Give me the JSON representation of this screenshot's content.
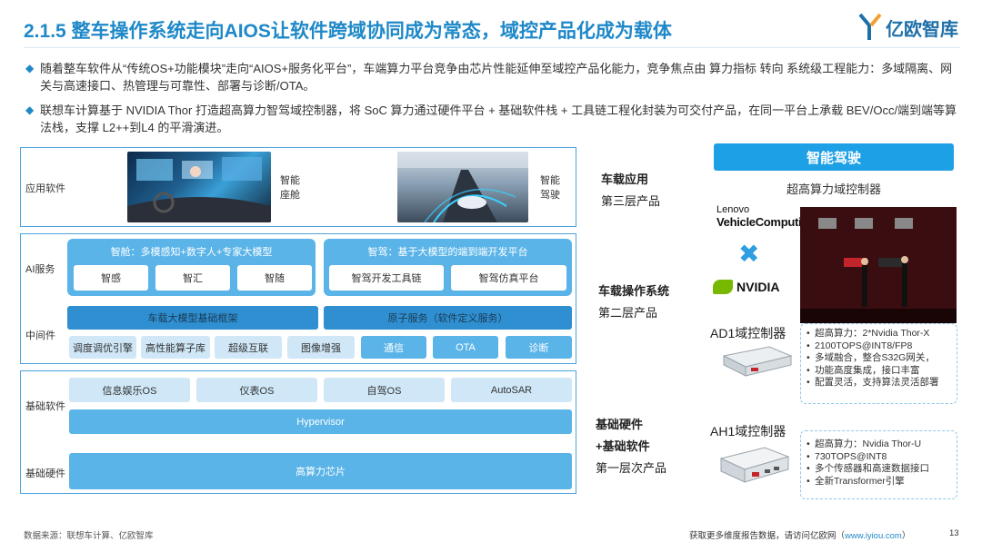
{
  "header": {
    "title": "2.1.5 整车操作系统走向AIOS让软件跨域协同成为常态，域控产品化成为载体",
    "logo_text": "亿欧智库"
  },
  "bullets": [
    "随着整车软件从“传统OS+功能模块”走向“AIOS+服务化平台”，车端算力平台竞争由芯片性能延伸至域控产品化能力，竞争焦点由 算力指标 转向 系统级工程能力：多域隔离、网关与高速接口、热管理与可靠性、部署与诊断/OTA。",
    "联想车计算基于 NVIDIA Thor 打造超高算力智驾域控制器，将 SoC 算力通过硬件平台 + 基础软件栈 + 工具链工程化封装为可交付产品，在同一平台上承载 BEV/Occ/端到端等算法栈，支撑 L2++到L4 的平滑演进。"
  ],
  "stack": {
    "app_row": {
      "label": "应用软件",
      "caption1": "智能\n座舱",
      "caption2": "智能\n驾驶"
    },
    "ai_row": {
      "label": "AI服务",
      "group1_title": "智舱：多模感知+数字人+专家大模型",
      "group1_items": [
        "智感",
        "智汇",
        "智随"
      ],
      "group2_title": "智驾：基于大模型的端到端开发平台",
      "group2_items": [
        "智驾开发工具链",
        "智驾仿真平台"
      ]
    },
    "middleware_row": {
      "label": "中间件",
      "top_left": "车载大模型基础框架",
      "top_right": "原子服务（软件定义服务）",
      "items": [
        "调度调优引擎",
        "高性能算子库",
        "超级互联",
        "图像增强",
        "通信",
        "OTA",
        "诊断"
      ]
    },
    "basesw_row": {
      "label": "基础软件",
      "items": [
        "信息娱乐OS",
        "仪表OS",
        "自驾OS",
        "AutoSAR"
      ],
      "hypervisor": "Hypervisor"
    },
    "hw_row": {
      "label": "基础硬件",
      "chip": "高算力芯片"
    }
  },
  "side_labels": {
    "layer3_title": "车载应用",
    "layer3_sub": "第三层产品",
    "layer2_title": "车载操作系统",
    "layer2_sub": "第二层产品",
    "layer1_title_a": "基础硬件",
    "layer1_title_b": "+基础软件",
    "layer1_sub": "第一层次产品"
  },
  "right_panel": {
    "banner": "智能驾驶",
    "subtitle": "超高算力域控制器",
    "lenovo_small": "Lenovo",
    "lenovo_big": "VehicleComputing",
    "nvidia": "NVIDIA",
    "ad1": {
      "title": "AD1域控制器",
      "specs": [
        "超高算力：2*Nvidia Thor-X",
        "2100TOPS@INT8/FP8",
        "多域融合，整合S32G网关，",
        "功能高度集成，接口丰富",
        "配置灵活，支持算法灵活部署"
      ]
    },
    "ah1": {
      "title": "AH1域控制器",
      "specs": [
        "超高算力：Nvidia Thor-U",
        "730TOPS@INT8",
        "多个传感器和高速数据接口",
        "全新Transformer引擎"
      ]
    }
  },
  "footer": {
    "source": "数据来源：联想车计算、亿欧智库",
    "more_prefix": "获取更多维度报告数据，请访问亿欧网（",
    "more_link": "www.iyiou.com",
    "more_suffix": "）",
    "page": "13"
  },
  "colors": {
    "accent": "#1e88c8",
    "banner": "#1ea0e6",
    "pill_dark": "#2f8fd0",
    "pill_mid": "#5ab4e8",
    "pill_light": "#cfe7f7"
  }
}
